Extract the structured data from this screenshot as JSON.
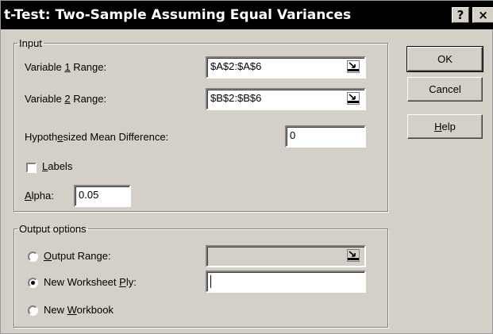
{
  "title": "t-Test: Two-Sample Assuming Equal Variances",
  "title_buttons": {
    "help": "?",
    "close": "×"
  },
  "input": {
    "legend": "Input",
    "var1": {
      "pre": "Variable ",
      "key": "1",
      "post": " Range:",
      "value": "$A$2:$A$6"
    },
    "var2": {
      "pre": "Variable ",
      "key": "2",
      "post": " Range:",
      "value": "$B$2:$B$6"
    },
    "hypo": {
      "pre": "Hypoth",
      "key": "e",
      "post": "sized Mean Difference:",
      "value": "0"
    },
    "labels": {
      "key": "L",
      "post": "abels",
      "checked": false
    },
    "alpha": {
      "key": "A",
      "post": "lpha:",
      "value": "0.05"
    }
  },
  "output": {
    "legend": "Output options",
    "output_range": {
      "key": "O",
      "post": "utput Range:",
      "value": "",
      "selected": false
    },
    "new_ply": {
      "pre": "New Worksheet ",
      "key": "P",
      "post": "ly:",
      "value": "",
      "selected": true
    },
    "new_workbook": {
      "pre": "New ",
      "key": "W",
      "post": "orkbook",
      "selected": false
    }
  },
  "buttons": {
    "ok": "OK",
    "cancel": "Cancel",
    "help_key": "H",
    "help_post": "elp"
  },
  "icons": {
    "collapse": "collapse-dialog-icon"
  }
}
